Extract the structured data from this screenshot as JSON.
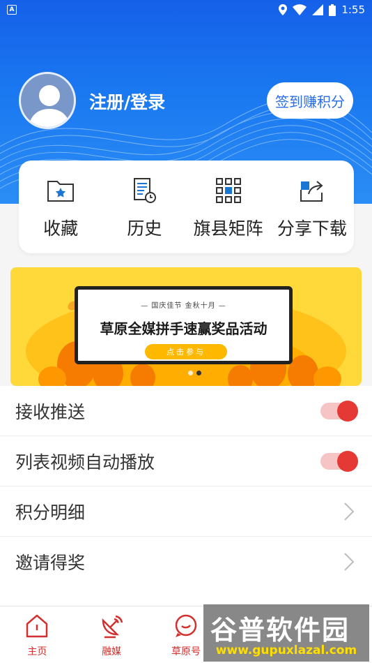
{
  "status_bar": {
    "time": "1:55",
    "left_badge": "A"
  },
  "profile": {
    "login_label": "注册/登录",
    "checkin_button": "签到赚积分"
  },
  "quick_actions": [
    {
      "label": "收藏",
      "icon": "folder-star-icon"
    },
    {
      "label": "历史",
      "icon": "history-document-icon"
    },
    {
      "label": "旗县矩阵",
      "icon": "grid-matrix-icon"
    },
    {
      "label": "分享下载",
      "icon": "share-icon"
    }
  ],
  "banner": {
    "subtitle": "— 国庆佳节  金秋十月 —",
    "title": "草原全媒拼手速赢奖品活动",
    "cta": "点击参与"
  },
  "settings": [
    {
      "label": "接收推送",
      "type": "toggle",
      "on": true
    },
    {
      "label": "列表视频自动播放",
      "type": "toggle",
      "on": true
    },
    {
      "label": "积分明细",
      "type": "link"
    },
    {
      "label": "邀请得奖",
      "type": "link"
    }
  ],
  "bottom_nav": [
    {
      "label": "主页",
      "icon": "home-icon"
    },
    {
      "label": "融媒",
      "icon": "satellite-icon"
    },
    {
      "label": "草原号",
      "icon": "chat-icon"
    },
    {
      "label": "",
      "icon": ""
    },
    {
      "label": "",
      "icon": ""
    }
  ],
  "watermark": {
    "logo": "谷普软件园",
    "url": "www.gupuxlazal.com"
  },
  "colors": {
    "accent": "#e53935",
    "header_blue": "#1a78f0",
    "banner_yellow": "#ffd83a"
  }
}
